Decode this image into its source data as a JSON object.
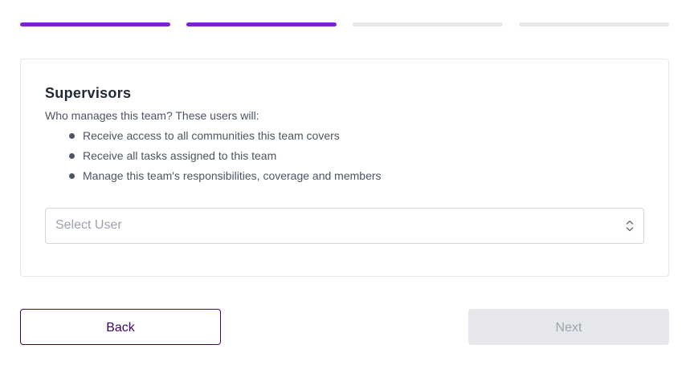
{
  "progress": {
    "total_steps": 4,
    "completed_steps": 2,
    "active_color": "#7e22ce",
    "inactive_color": "#e5e7eb"
  },
  "card": {
    "title": "Supervisors",
    "description": "Who manages this team? These users will:",
    "bullets": [
      "Receive access to all communities this team covers",
      "Receive all tasks assigned to this team",
      "Manage this team's responsibilities, coverage and members"
    ],
    "select": {
      "placeholder": "Select User",
      "icon": "chevron-up-down-icon"
    }
  },
  "footer": {
    "back_label": "Back",
    "next_label": "Next",
    "next_disabled": true
  }
}
